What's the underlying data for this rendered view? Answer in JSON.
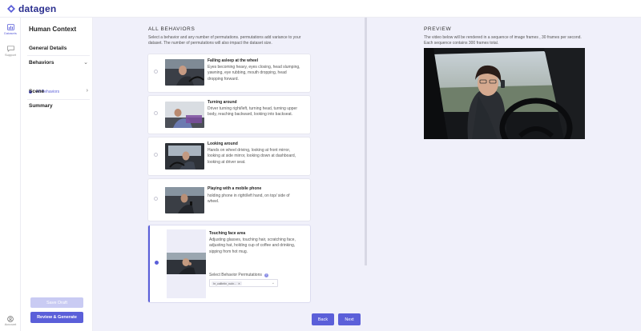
{
  "app": {
    "name": "datagen"
  },
  "rail": {
    "datasets_label": "Datasets",
    "support_label": "Support",
    "account_label": "Account"
  },
  "steps": {
    "title": "Human Context",
    "general": "General Details",
    "behaviors": "Behaviors",
    "all_behaviors": "All Behaviors",
    "scene": "Scene",
    "summary": "Summary",
    "save_draft": "Save Draft",
    "review_generate": "Review & Generate"
  },
  "main": {
    "title": "ALL BEHAVIORS",
    "description": "Select a behavior and any number of permutations. permutations add variance to your dataset. The number of permutations will also impact the dataset size.",
    "behaviors": [
      {
        "title": "Falling asleep at the wheel",
        "desc": "Eyes becoming heavy, eyes closing, head slumping, yawning, eye rubbing, mouth dropping, head dropping forward.",
        "selected": false
      },
      {
        "title": "Turning around",
        "desc": "Driver turning right/left, turning head, turning upper body, reaching backward, looking into backseat.",
        "selected": false
      },
      {
        "title": "Looking around",
        "desc": "Hands on wheel driving, looking at front mirror, looking at side mirror, looking down at dashboard, looking at driver seat.",
        "selected": false
      },
      {
        "title": "Playing with a mobile phone",
        "desc": "holding phone in right/left hand, on top/ side of wheel.",
        "selected": false
      },
      {
        "title": "Touching face area",
        "desc": "Adjusting glasses, touching hair, scratching face, adjusting hat, holding cup of coffee and drinking, sipping from hot mug.",
        "selected": true
      }
    ],
    "permutations_label": "Select Behavior Permutations",
    "permutation_chip": "hr_calibrtin_rudn...",
    "back": "Back",
    "next": "Next"
  },
  "preview": {
    "title": "PREVIEW",
    "description": "The video below will be rendered in a sequence of image frames , 30 frames per second. Each sequence contains 300 frames total."
  },
  "colors": {
    "accent": "#5b5fd9",
    "panel_bg": "#f0f0fa"
  }
}
